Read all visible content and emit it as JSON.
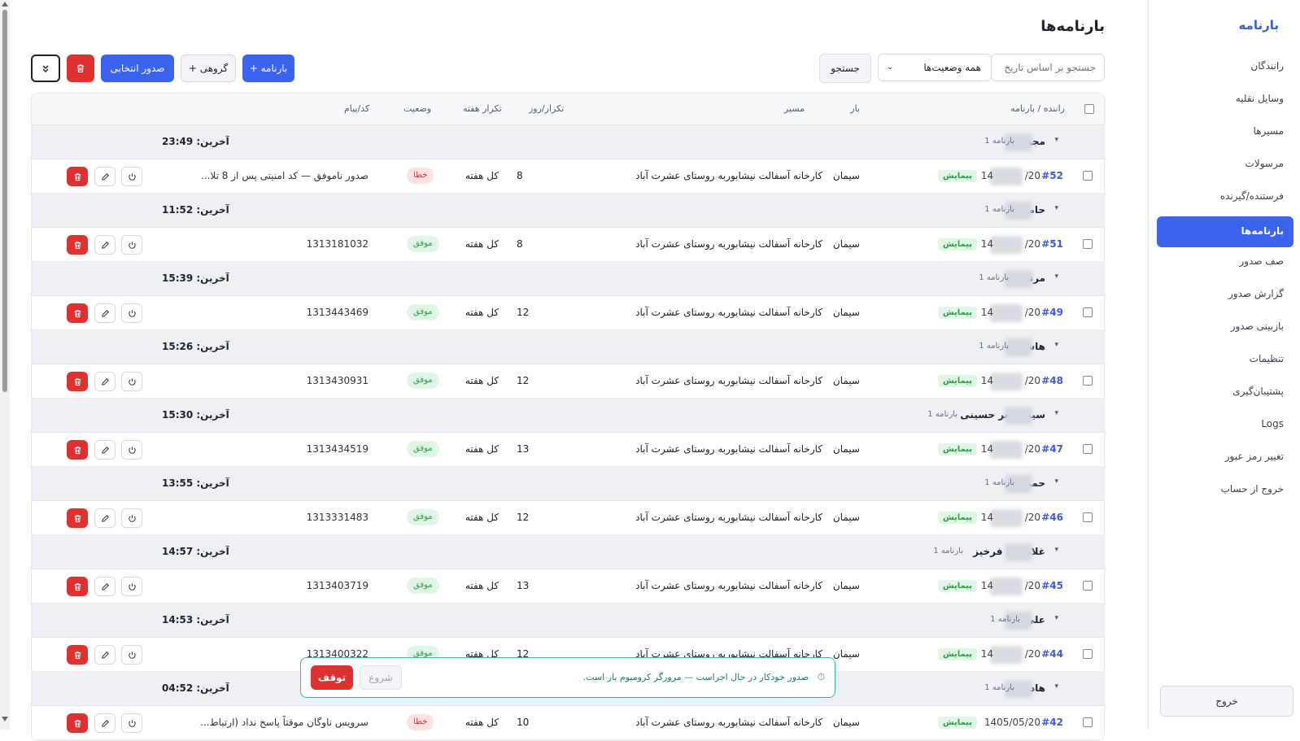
{
  "sidebar": {
    "brand": "بارنامه",
    "items": [
      {
        "label": "رانندگان"
      },
      {
        "label": "وسایل نقلیه"
      },
      {
        "label": "مسیرها"
      },
      {
        "label": "مرسولات"
      },
      {
        "label": "فرستنده/گیرنده"
      },
      {
        "label": "بارنامه‌ها",
        "active": true
      },
      {
        "label": "صف صدور"
      },
      {
        "label": "گزارش صدور"
      },
      {
        "label": "بازبینی صدور"
      },
      {
        "label": "تنظیمات"
      },
      {
        "label": "پشتیبان‌گیری"
      },
      {
        "label": "Logs"
      },
      {
        "label": "تغییر رمز عبور"
      },
      {
        "label": "خروج از حساب"
      }
    ],
    "logout": "خروج"
  },
  "page": {
    "title": "بارنامه‌ها"
  },
  "toolbar": {
    "date_search_placeholder": "جستجو بر اساس تاریخ",
    "status_filter": "همه وضعیت‌ها",
    "search_label": "جستجو",
    "add_bar_label": "+ بارنامه",
    "add_group_label": "+ گروهی",
    "issue_selected_label": "صدور انتخابی"
  },
  "table": {
    "headers": {
      "driver": "راننده / بارنامه",
      "load": "بار",
      "route": "مسیر",
      "per_day": "تکرار/روز",
      "per_week": "تکرار هفته",
      "status": "وضعیت",
      "code": "کد/پیام"
    },
    "groups": [
      {
        "name": "مجید",
        "count": "1 بارنامه",
        "last": "آخرین: 23:49",
        "row": {
          "id": "#52",
          "date_prefix": "/20",
          "date_suffix": "14",
          "badge": "پیمایش",
          "load": "سیمان",
          "route": "کارخانه آسفالت نیشابوربه روستای عشرت آباد",
          "per_day": "8",
          "week": "کل هفته",
          "status": "خطا",
          "status_type": "err",
          "code": "صدور ناموفق — کد امنیتی پس از 8 تلا..."
        }
      },
      {
        "name": "حامد",
        "count": "1 بارنامه",
        "last": "آخرین: 11:52",
        "row": {
          "id": "#51",
          "date_prefix": "/20",
          "date_suffix": "14",
          "badge": "پیمایش",
          "load": "سیمان",
          "route": "کارخانه آسفالت نیشابوربه روستای عشرت آباد",
          "per_day": "8",
          "week": "کل هفته",
          "status": "موفق",
          "status_type": "ok",
          "code": "1313181032"
        }
      },
      {
        "name": "مرتضی",
        "count": "1 بارنامه",
        "last": "آخرین: 15:39",
        "row": {
          "id": "#49",
          "date_prefix": "/20",
          "date_suffix": "14",
          "badge": "پیمایش",
          "load": "سیمان",
          "route": "کارخانه آسفالت نیشابوربه روستای عشرت آباد",
          "per_day": "12",
          "week": "کل هفته",
          "status": "موفق",
          "status_type": "ok",
          "code": "1313443469"
        }
      },
      {
        "name": "هاشمی",
        "count": "1 بارنامه",
        "last": "آخرین: 15:26",
        "row": {
          "id": "#48",
          "date_prefix": "/20",
          "date_suffix": "14",
          "badge": "پیمایش",
          "load": "سیمان",
          "route": "کارخانه آسفالت نیشابوربه روستای عشرت آباد",
          "per_day": "12",
          "week": "کل هفته",
          "status": "موفق",
          "status_type": "ok",
          "code": "1313430931"
        }
      },
      {
        "name": "سید اصغر حسینی",
        "count": "1 بارنامه",
        "last": "آخرین: 15:30",
        "row": {
          "id": "#47",
          "date_prefix": "/20",
          "date_suffix": "14",
          "badge": "پیمایش",
          "load": "سیمان",
          "route": "کارخانه آسفالت نیشابوربه روستای عشرت آباد",
          "per_day": "13",
          "week": "کل هفته",
          "status": "موفق",
          "status_type": "ok",
          "code": "1313434519"
        }
      },
      {
        "name": "حمید",
        "count": "1 بارنامه",
        "last": "آخرین: 13:55",
        "row": {
          "id": "#46",
          "date_prefix": "/20",
          "date_suffix": "14",
          "badge": "پیمایش",
          "load": "سیمان",
          "route": "کارخانه آسفالت نیشابوربه روستای عشرت آباد",
          "per_day": "12",
          "week": "کل هفته",
          "status": "موفق",
          "status_type": "ok",
          "code": "1313331483"
        }
      },
      {
        "name": "غلامرضا فرخیز",
        "count": "1 بارنامه",
        "last": "آخرین: 14:57",
        "row": {
          "id": "#45",
          "date_prefix": "/20",
          "date_suffix": "14",
          "badge": "پیمایش",
          "load": "سیمان",
          "route": "کارخانه آسفالت نیشابوربه روستای عشرت آباد",
          "per_day": "13",
          "week": "کل هفته",
          "status": "موفق",
          "status_type": "ok",
          "code": "1313403719"
        }
      },
      {
        "name": "علی",
        "count": "1 بارنامه",
        "last": "آخرین: 14:53",
        "row": {
          "id": "#44",
          "date_prefix": "/20",
          "date_suffix": "14",
          "badge": "پیمایش",
          "load": "سیمان",
          "route": "کارخانه آسفالت نیشابوربه روستای عشرت آباد",
          "per_day": "12",
          "week": "کل هفته",
          "status": "موفق",
          "status_type": "ok",
          "code": "1313400322"
        }
      },
      {
        "name": "هادی",
        "count": "1 بارنامه",
        "last": "آخرین: 04:52",
        "row": {
          "id": "#42",
          "date_prefix": "1405/05/20",
          "date_suffix": "",
          "badge": "پیمایش",
          "load": "سیمان",
          "route": "کارخانه آسفالت نیشابوربه روستای عشرت آباد",
          "per_day": "10",
          "week": "کل هفته",
          "status": "خطا",
          "status_type": "err",
          "code": "سرویس ناوگان موقتاً پاسخ نداد (ارتباط..."
        }
      }
    ]
  },
  "toast": {
    "message": "صدور خودکار در حال اجراست — مرورگر کرومیوم باز است.",
    "start_label": "شروع",
    "stop_label": "توقف"
  },
  "colors": {
    "primary": "#3b63ee",
    "danger": "#e03131",
    "success": "#2f9e44"
  }
}
